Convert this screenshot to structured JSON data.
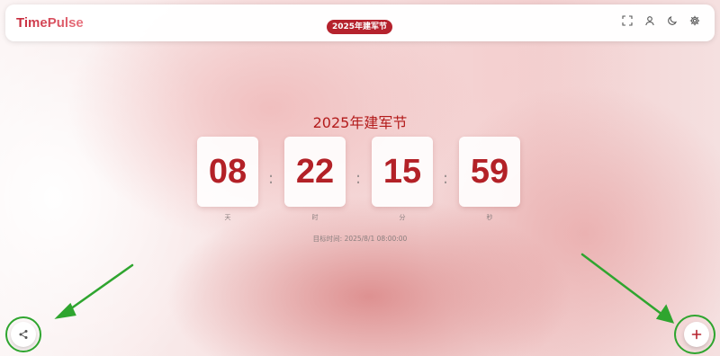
{
  "app": {
    "brand": "TimePulse"
  },
  "header": {
    "event_badge": "2025年建军节",
    "icons": [
      "fullscreen-icon",
      "user-icon",
      "moon-icon",
      "gear-icon"
    ]
  },
  "countdown": {
    "title": "2025年建军节",
    "days": "08",
    "hours": "22",
    "minutes": "15",
    "seconds": "59",
    "unit_days": "天",
    "unit_hours": "时",
    "unit_minutes": "分",
    "unit_seconds": "秒",
    "separator": ":",
    "target_time": "目标时间: 2025/8/1 08:00:00"
  },
  "actions": {
    "share_icon": "share-icon",
    "add_icon": "plus-icon"
  },
  "colors": {
    "accent": "#b5222d",
    "digit": "#b32127",
    "annotation_green": "#2fa52f"
  }
}
